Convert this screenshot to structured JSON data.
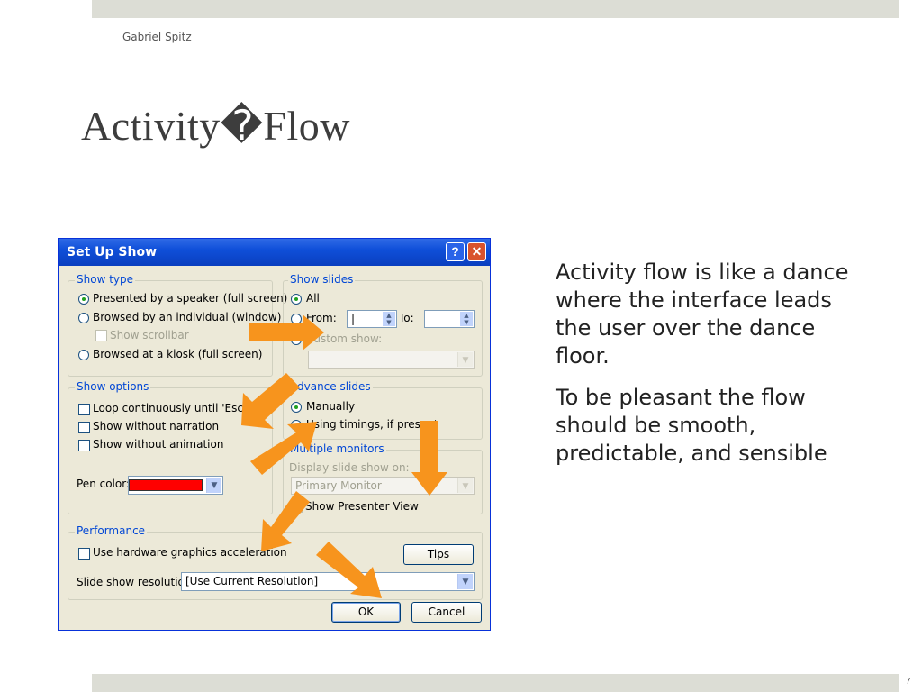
{
  "slide": {
    "author": "Gabriel Spitz",
    "title": "Activity�Flow",
    "page_number": "7",
    "body": [
      "Activity flow is like a dance where the interface leads the user over the dance floor.",
      "To be pleasant the flow should be smooth, predictable, and sensible"
    ]
  },
  "dialog": {
    "title": "Set Up Show",
    "help_glyph": "?",
    "close_glyph": "✕",
    "show_type": {
      "label": "Show type",
      "presented": "Presented by a speaker (full screen)",
      "browsed_individual": "Browsed by an individual (window)",
      "show_scrollbar": "Show scrollbar",
      "browsed_kiosk": "Browsed at a kiosk (full screen)"
    },
    "show_slides": {
      "label": "Show slides",
      "all": "All",
      "from": "From:",
      "to": "To:",
      "custom_show": "Custom show:"
    },
    "show_options": {
      "label": "Show options",
      "loop": "Loop continuously until 'Esc'",
      "no_narration": "Show without narration",
      "no_animation": "Show without animation",
      "pen_color": "Pen color:"
    },
    "advance_slides": {
      "label": "Advance slides",
      "manually": "Manually",
      "timings": "Using timings, if present"
    },
    "multiple_monitors": {
      "label": "Multiple monitors",
      "display_on": "Display slide show on:",
      "monitor_value": "Primary Monitor",
      "presenter_view": "Show Presenter View"
    },
    "performance": {
      "label": "Performance",
      "hw_accel": "Use hardware graphics acceleration",
      "tips": "Tips",
      "resolution_label": "Slide show resolution:",
      "resolution_value": "[Use Current Resolution]"
    },
    "ok": "OK",
    "cancel": "Cancel"
  },
  "colors": {
    "arrow": "#f7941d",
    "pen_color": "#ff0000",
    "titlebar": "#0f4fd9"
  }
}
